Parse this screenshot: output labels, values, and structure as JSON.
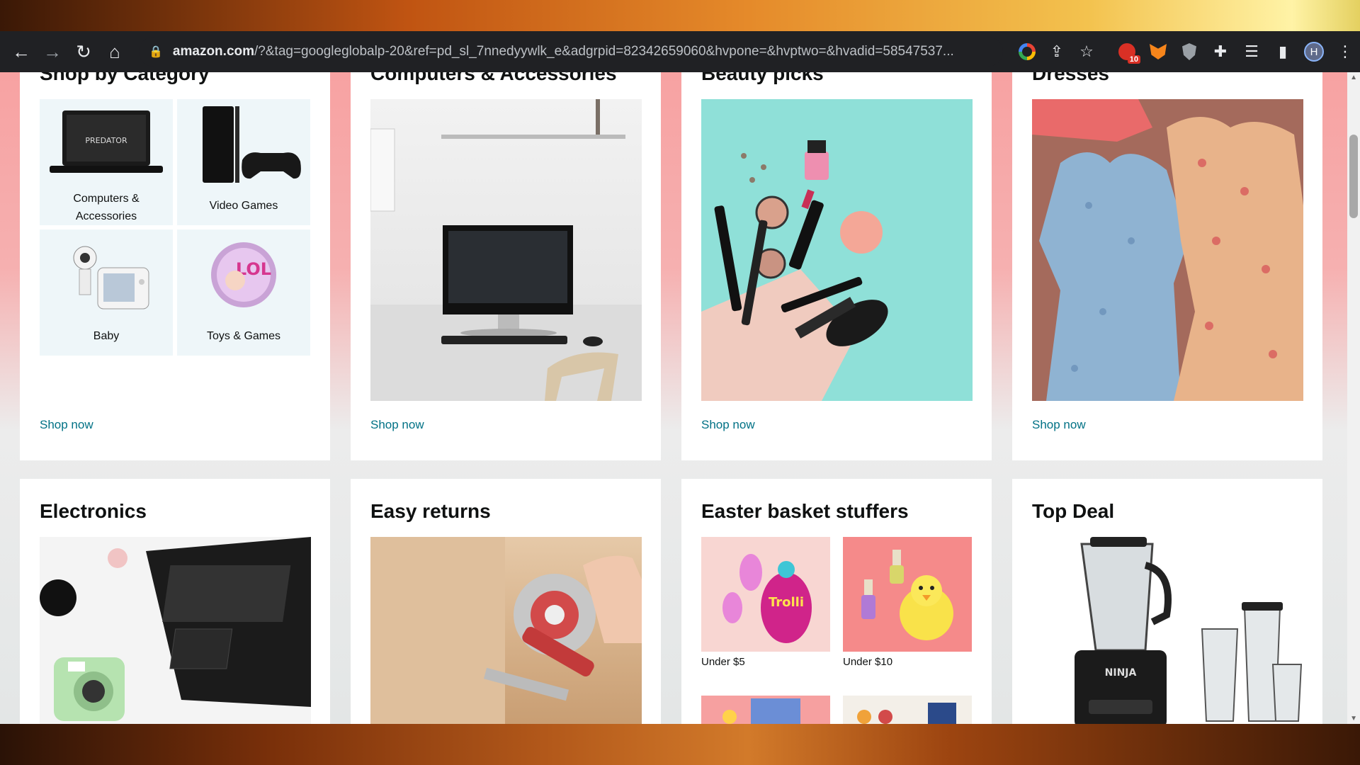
{
  "browser": {
    "url_domain": "amazon.com",
    "url_rest": "/?&tag=googleglobalp-20&ref=pd_sl_7nnedyywlk_e&adgrpid=82342659060&hvpone=&hvptwo=&hvadid=58547537...",
    "extension_badge": "10",
    "avatar_letter": "H"
  },
  "cards": {
    "shop_by_category": {
      "title": "Shop by Category",
      "tiles": [
        "Computers & Accessories",
        "Video Games",
        "Baby",
        "Toys & Games"
      ],
      "cta": "Shop now"
    },
    "computers": {
      "title": "Computers & Accessories",
      "cta": "Shop now"
    },
    "beauty": {
      "title": "Beauty picks",
      "cta": "Shop now"
    },
    "dresses": {
      "title": "Dresses",
      "cta": "Shop now"
    },
    "electronics": {
      "title": "Electronics"
    },
    "easy_returns": {
      "title": "Easy returns"
    },
    "easter": {
      "title": "Easter basket stuffers",
      "sub": [
        "Under $5",
        "Under $10"
      ]
    },
    "top_deal": {
      "title": "Top Deal"
    }
  },
  "colors": {
    "link": "#007185",
    "toolbar": "#202124"
  }
}
